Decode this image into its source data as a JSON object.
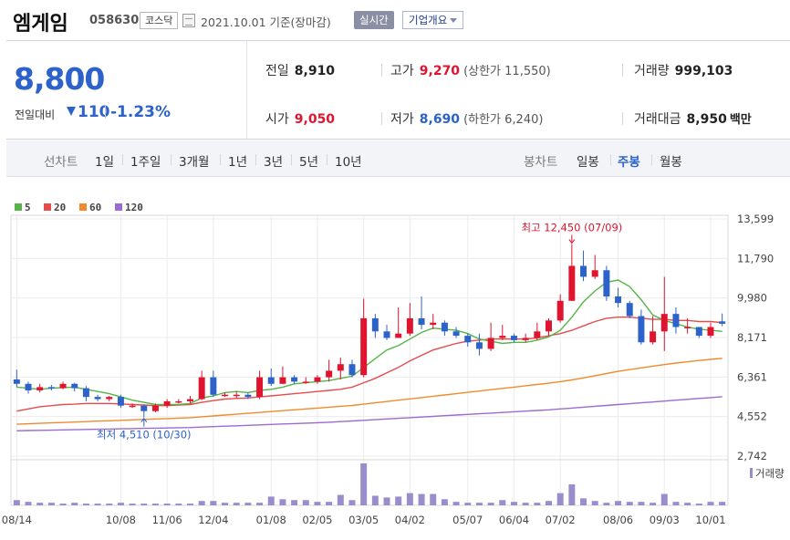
{
  "header": {
    "company_name": "엠게임",
    "stock_code": "058630",
    "market": "코스닥",
    "date_text": "2021.10.01 기준(장마감)",
    "realtime_label": "실시간",
    "overview_label": "기업개요"
  },
  "quote": {
    "current_price": "8,800",
    "change_label": "전일대비",
    "change_amount": "110",
    "change_percent": "-1.23%",
    "prev_close_label": "전일",
    "prev_close": "8,910",
    "open_label": "시가",
    "open": "9,050",
    "high_label": "고가",
    "high": "9,270",
    "upper_limit": "(상한가 11,550)",
    "low_label": "저가",
    "low": "8,690",
    "lower_limit": "(하한가 6,240)",
    "volume_label": "거래량",
    "volume": "999,103",
    "value_label": "거래대금",
    "value": "8,950",
    "value_unit": "백만"
  },
  "tabs": {
    "line_chart_label": "선차트",
    "line_periods": [
      "1일",
      "1주일",
      "3개월",
      "1년",
      "3년",
      "5년",
      "10년"
    ],
    "candle_chart_label": "봉차트",
    "candle_periods": [
      "일봉",
      "주봉",
      "월봉"
    ],
    "active_candle": "주봉"
  },
  "colors": {
    "up": "#e0142e",
    "down": "#2c62c9",
    "ma5": "#55b547",
    "ma20": "#e64c4c",
    "ma60": "#f08b2c",
    "ma120": "#9b6bd1",
    "volume": "#9b8dcb"
  },
  "chart_data": {
    "type": "candlestick",
    "interval": "weekly",
    "legend": [
      "5",
      "20",
      "60",
      "120"
    ],
    "yticks": [
      "13,599",
      "11,790",
      "9,980",
      "8,171",
      "6,361",
      "4,552",
      "2,742"
    ],
    "ytick_values": [
      13599,
      11790,
      9980,
      8171,
      6361,
      4552,
      2742
    ],
    "ylim": [
      2742,
      13599
    ],
    "xticks": [
      "08/14",
      "10/08",
      "11/06",
      "12/04",
      "01/08",
      "02/05",
      "03/05",
      "04/02",
      "05/07",
      "06/04",
      "07/02",
      "08/06",
      "09/03",
      "10/01"
    ],
    "xtick_index": [
      0,
      9,
      13,
      17,
      22,
      26,
      30,
      34,
      39,
      43,
      47,
      52,
      56,
      60
    ],
    "high_annotation": "최고 12,450 (07/09)",
    "low_annotation": "최저 4,510 (10/30)",
    "volume_label": "거래량",
    "candles": [
      {
        "o": 6250,
        "c": 6050,
        "h": 6700,
        "l": 5900
      },
      {
        "o": 6050,
        "c": 5750,
        "h": 6150,
        "l": 5600
      },
      {
        "o": 5750,
        "c": 5900,
        "h": 6050,
        "l": 5650
      },
      {
        "o": 5900,
        "c": 5850,
        "h": 6000,
        "l": 5750
      },
      {
        "o": 5850,
        "c": 6050,
        "h": 6150,
        "l": 5800
      },
      {
        "o": 6050,
        "c": 5850,
        "h": 6100,
        "l": 5700
      },
      {
        "o": 5850,
        "c": 5450,
        "h": 5950,
        "l": 5250
      },
      {
        "o": 5450,
        "c": 5350,
        "h": 5550,
        "l": 5250
      },
      {
        "o": 5350,
        "c": 5450,
        "h": 5500,
        "l": 5250
      },
      {
        "o": 5450,
        "c": 5050,
        "h": 5550,
        "l": 4950
      },
      {
        "o": 5050,
        "c": 5050,
        "h": 5150,
        "l": 4950
      },
      {
        "o": 5050,
        "c": 4800,
        "h": 5100,
        "l": 4510
      },
      {
        "o": 4800,
        "c": 5050,
        "h": 5150,
        "l": 4750
      },
      {
        "o": 5050,
        "c": 5250,
        "h": 5350,
        "l": 4950
      },
      {
        "o": 5250,
        "c": 5250,
        "h": 5350,
        "l": 5150
      },
      {
        "o": 5250,
        "c": 5350,
        "h": 5500,
        "l": 5150
      },
      {
        "o": 5350,
        "c": 6350,
        "h": 6650,
        "l": 5300
      },
      {
        "o": 6350,
        "c": 5550,
        "h": 6650,
        "l": 5450
      },
      {
        "o": 5550,
        "c": 5550,
        "h": 5650,
        "l": 5450
      },
      {
        "o": 5550,
        "c": 5550,
        "h": 5700,
        "l": 5400
      },
      {
        "o": 5550,
        "c": 5450,
        "h": 5650,
        "l": 5350
      },
      {
        "o": 5450,
        "c": 6350,
        "h": 6650,
        "l": 5350
      },
      {
        "o": 6350,
        "c": 6050,
        "h": 6750,
        "l": 5950
      },
      {
        "o": 6050,
        "c": 6350,
        "h": 6850,
        "l": 6050
      },
      {
        "o": 6350,
        "c": 6150,
        "h": 6450,
        "l": 6050
      },
      {
        "o": 6150,
        "c": 6150,
        "h": 6350,
        "l": 6050
      },
      {
        "o": 6150,
        "c": 6350,
        "h": 6450,
        "l": 6050
      },
      {
        "o": 6350,
        "c": 6650,
        "h": 7150,
        "l": 6150
      },
      {
        "o": 6650,
        "c": 6950,
        "h": 7250,
        "l": 6250
      },
      {
        "o": 6950,
        "c": 6450,
        "h": 7150,
        "l": 6350
      },
      {
        "o": 6450,
        "c": 9050,
        "h": 9950,
        "l": 6350
      },
      {
        "o": 9050,
        "c": 8450,
        "h": 9250,
        "l": 8150
      },
      {
        "o": 8450,
        "c": 8150,
        "h": 8750,
        "l": 8050
      },
      {
        "o": 8150,
        "c": 8350,
        "h": 9550,
        "l": 8150
      },
      {
        "o": 8350,
        "c": 9050,
        "h": 9750,
        "l": 8250
      },
      {
        "o": 9050,
        "c": 8750,
        "h": 10050,
        "l": 8550
      },
      {
        "o": 8750,
        "c": 8850,
        "h": 9250,
        "l": 8550
      },
      {
        "o": 8850,
        "c": 8450,
        "h": 8950,
        "l": 8250
      },
      {
        "o": 8450,
        "c": 8250,
        "h": 8650,
        "l": 8150
      },
      {
        "o": 8250,
        "c": 7950,
        "h": 8350,
        "l": 7750
      },
      {
        "o": 7950,
        "c": 7650,
        "h": 8350,
        "l": 7350
      },
      {
        "o": 7650,
        "c": 8150,
        "h": 8850,
        "l": 7550
      },
      {
        "o": 8150,
        "c": 8250,
        "h": 8750,
        "l": 8050
      },
      {
        "o": 8250,
        "c": 8050,
        "h": 8350,
        "l": 7950
      },
      {
        "o": 8050,
        "c": 8150,
        "h": 8350,
        "l": 7950
      },
      {
        "o": 8150,
        "c": 8450,
        "h": 8850,
        "l": 8050
      },
      {
        "o": 8450,
        "c": 8950,
        "h": 9050,
        "l": 8250
      },
      {
        "o": 8950,
        "c": 9850,
        "h": 10150,
        "l": 8850
      },
      {
        "o": 9850,
        "c": 11450,
        "h": 12450,
        "l": 9850
      },
      {
        "o": 11450,
        "c": 10950,
        "h": 12150,
        "l": 10750
      },
      {
        "o": 10950,
        "c": 11250,
        "h": 11950,
        "l": 10850
      },
      {
        "o": 11250,
        "c": 10050,
        "h": 11450,
        "l": 9850
      },
      {
        "o": 10050,
        "c": 9750,
        "h": 10450,
        "l": 9550
      },
      {
        "o": 9750,
        "c": 9150,
        "h": 9850,
        "l": 9050
      },
      {
        "o": 9150,
        "c": 7950,
        "h": 9450,
        "l": 7850
      },
      {
        "o": 7950,
        "c": 8450,
        "h": 9150,
        "l": 7850
      },
      {
        "o": 8450,
        "c": 9250,
        "h": 10950,
        "l": 7550
      },
      {
        "o": 9250,
        "c": 8650,
        "h": 9550,
        "l": 8350
      },
      {
        "o": 8650,
        "c": 8650,
        "h": 9050,
        "l": 8350
      },
      {
        "o": 8650,
        "c": 8250,
        "h": 8650,
        "l": 8150
      },
      {
        "o": 8250,
        "c": 8650,
        "h": 8850,
        "l": 8150
      },
      {
        "o": 8910,
        "c": 8800,
        "h": 9270,
        "l": 8690
      }
    ],
    "ma5": [
      5900,
      5850,
      5800,
      5850,
      5880,
      5900,
      5800,
      5700,
      5600,
      5450,
      5300,
      5200,
      5100,
      5100,
      5100,
      5150,
      5400,
      5500,
      5650,
      5700,
      5650,
      5750,
      5800,
      5900,
      6050,
      6100,
      6150,
      6200,
      6300,
      6400,
      6800,
      7200,
      7600,
      7800,
      8100,
      8400,
      8600,
      8550,
      8500,
      8350,
      8100,
      8000,
      7900,
      7950,
      7950,
      8050,
      8200,
      8500,
      9100,
      9800,
      10300,
      10700,
      10800,
      10500,
      9900,
      9200,
      8950,
      8800,
      8650,
      8550,
      8500,
      8450
    ],
    "ma20": [
      4800,
      4900,
      5000,
      5050,
      5100,
      5120,
      5150,
      5150,
      5150,
      5130,
      5100,
      5080,
      5050,
      5050,
      5080,
      5100,
      5200,
      5280,
      5350,
      5380,
      5400,
      5450,
      5500,
      5550,
      5600,
      5650,
      5700,
      5750,
      5800,
      5900,
      6100,
      6300,
      6550,
      6800,
      7100,
      7350,
      7600,
      7750,
      7900,
      8000,
      8050,
      8100,
      8100,
      8100,
      8100,
      8150,
      8250,
      8350,
      8500,
      8700,
      8900,
      9050,
      9100,
      9100,
      9050,
      9000,
      9000,
      8950,
      8950,
      8900,
      8900,
      8850
    ],
    "ma60": [
      4200,
      4220,
      4240,
      4260,
      4280,
      4300,
      4320,
      4340,
      4360,
      4380,
      4400,
      4420,
      4440,
      4460,
      4480,
      4500,
      4540,
      4580,
      4620,
      4660,
      4700,
      4740,
      4780,
      4820,
      4860,
      4900,
      4940,
      4980,
      5020,
      5060,
      5120,
      5180,
      5240,
      5300,
      5360,
      5420,
      5480,
      5540,
      5600,
      5660,
      5720,
      5780,
      5840,
      5900,
      5960,
      6020,
      6080,
      6150,
      6230,
      6320,
      6420,
      6520,
      6620,
      6700,
      6780,
      6860,
      6930,
      7000,
      7060,
      7120,
      7170,
      7220
    ],
    "ma120": [
      3900,
      3910,
      3920,
      3930,
      3940,
      3950,
      3960,
      3970,
      3980,
      3990,
      4000,
      4010,
      4020,
      4030,
      4040,
      4050,
      4070,
      4090,
      4110,
      4130,
      4150,
      4170,
      4190,
      4210,
      4230,
      4250,
      4270,
      4290,
      4320,
      4350,
      4380,
      4410,
      4440,
      4470,
      4500,
      4530,
      4560,
      4590,
      4620,
      4650,
      4680,
      4710,
      4740,
      4770,
      4800,
      4830,
      4860,
      4900,
      4940,
      4980,
      5020,
      5060,
      5100,
      5140,
      5180,
      5220,
      5260,
      5300,
      5340,
      5380,
      5420,
      5460
    ],
    "volume": [
      6,
      4,
      3,
      3,
      2,
      3,
      2,
      2,
      2,
      3,
      2,
      2,
      2,
      2,
      2,
      2,
      5,
      5,
      3,
      3,
      3,
      3,
      10,
      7,
      6,
      6,
      4,
      4,
      12,
      6,
      48,
      11,
      9,
      10,
      14,
      13,
      13,
      7,
      4,
      3,
      3,
      3,
      6,
      4,
      3,
      3,
      5,
      14,
      24,
      8,
      5,
      3,
      5,
      4,
      4,
      3,
      13,
      4,
      3,
      2,
      4,
      4
    ]
  }
}
